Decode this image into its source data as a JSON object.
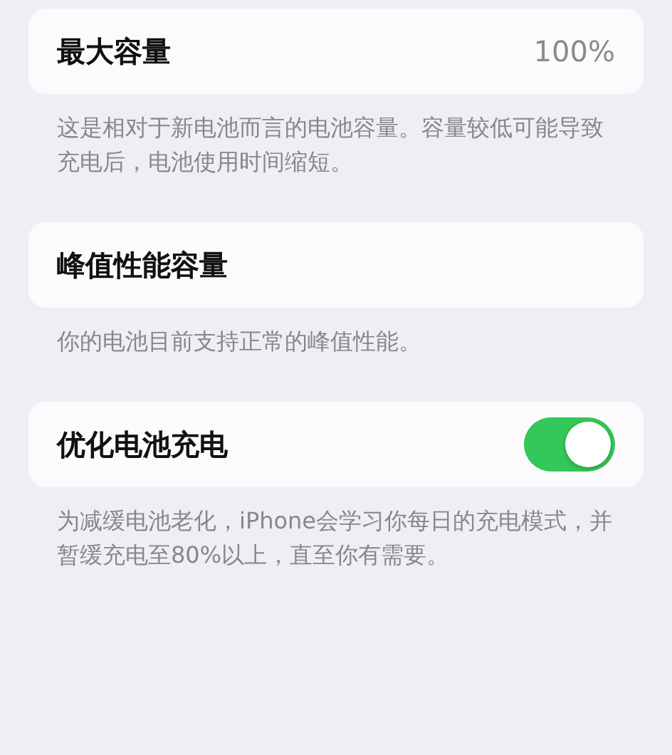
{
  "sections": [
    {
      "row": {
        "kind": "value",
        "label": "最大容量",
        "value": "100%"
      },
      "footer": "这是相对于新电池而言的电池容量。容量较低可能导致充电后，电池使用时间缩短。"
    },
    {
      "row": {
        "kind": "plain",
        "label": "峰值性能容量"
      },
      "footer": "你的电池目前支持正常的峰值性能。"
    },
    {
      "row": {
        "kind": "toggle",
        "label": "优化电池充电",
        "on": true
      },
      "footer": "为减缓电池老化，iPhone会学习你每日的充电模式，并暂缓充电至80%以上，直至你有需要。"
    }
  ]
}
